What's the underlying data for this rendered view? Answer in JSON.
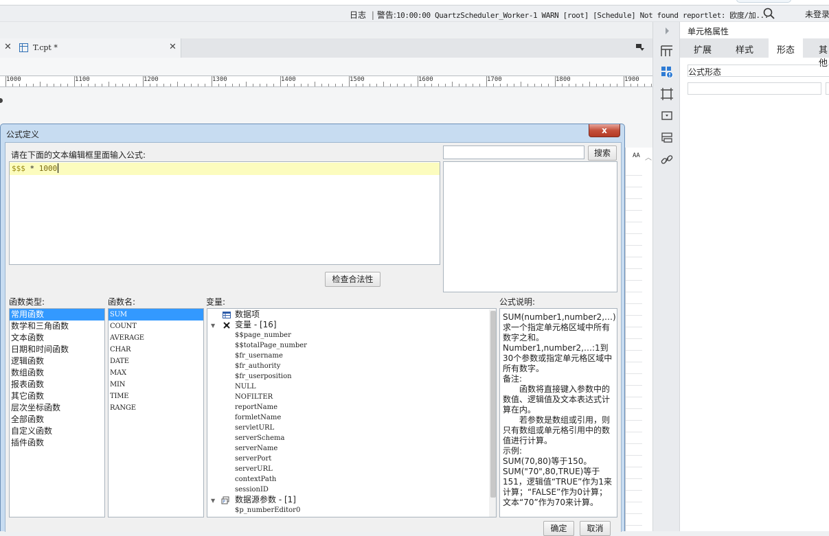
{
  "status_bar": {
    "log_label": "日志",
    "separator": "|",
    "warning_prefix": "警告:",
    "warning_message": "10:00:00 QuartzScheduler_Worker-1 WARN [root] [Schedule] Not found reportlet: 欧度/加...",
    "login_text": "未登录"
  },
  "tabs": [
    {
      "label": "T.cpt *",
      "modified": true
    }
  ],
  "ruler": {
    "labels": [
      "1000",
      "1100",
      "1200",
      "1300",
      "1400",
      "1500",
      "1600",
      "1700",
      "1800",
      "1900"
    ]
  },
  "sheet": {
    "header_label": "AA"
  },
  "icons": {
    "strip": [
      "expand-right-icon",
      "cell-element-icon",
      "cell-attribute-icon",
      "border-icon",
      "widget-icon",
      "condition-icon",
      "hyperlink-icon"
    ],
    "tab_file_icon": "grid-file-icon",
    "search_icon": "magnifier-icon"
  },
  "properties_panel": {
    "title": "单元格属性",
    "tabs": [
      "扩展",
      "样式",
      "形态",
      "其他"
    ],
    "active_tab": "形态",
    "format_label": "公式形态",
    "format_value": ""
  },
  "dialog": {
    "title": "公式定义",
    "close_label": "x",
    "prompt": "请在下面的文本编辑框里面输入公式:",
    "formula": {
      "var": "$$$",
      "op": " * ",
      "num": "1000"
    },
    "search_placeholder": "",
    "search_button": "搜索",
    "check_button": "检查合法性",
    "function_type_label": "函数类型:",
    "function_name_label": "函数名:",
    "variable_label": "变量:",
    "description_label": "公式说明:",
    "function_types": [
      "常用函数",
      "数学和三角函数",
      "文本函数",
      "日期和时间函数",
      "逻辑函数",
      "数组函数",
      "报表函数",
      "其它函数",
      "层次坐标函数",
      "全部函数",
      "自定义函数",
      "插件函数"
    ],
    "selected_function_type": "常用函数",
    "function_names": [
      "SUM",
      "COUNT",
      "AVERAGE",
      "CHAR",
      "DATE",
      "MAX",
      "MIN",
      "TIME",
      "RANGE"
    ],
    "selected_function_name": "SUM",
    "variables": {
      "data_items": "数据项",
      "variable_group": "变量 - [16]",
      "variable_items": [
        "$$page_number",
        "$$totalPage_number",
        "$fr_username",
        "$fr_authority",
        "$fr_userposition",
        "NULL",
        "NOFILTER",
        "reportName",
        "formletName",
        "servletURL",
        "serverSchema",
        "serverName",
        "serverPort",
        "serverURL",
        "contextPath",
        "sessionID"
      ],
      "datasource_group": "数据源参数 - [1]",
      "datasource_items": [
        "$p_numberEditor0"
      ]
    },
    "description": [
      {
        "text": "SUM(number1,number2,…): 求一个指定单元格区域中所有数字之和。",
        "indent": false
      },
      {
        "text": "Number1,number2,…:1到30个参数或指定单元格区域中所有数字。",
        "indent": false
      },
      {
        "text": "备注:",
        "indent": false
      },
      {
        "text": "函数将直接键入参数中的数值、逻辑值及文本表达式计算在内。",
        "indent": true
      },
      {
        "text": "若参数是数组或引用，则只有数组或单元格引用中的数值进行计算。",
        "indent": true
      },
      {
        "text": "示例:",
        "indent": false
      },
      {
        "text": "SUM(70,80)等于150。",
        "indent": false
      },
      {
        "text": "SUM(\"70\",80,TRUE)等于151，逻辑值“TRUE”作为1来计算；“FALSE”作为0计算；文本“70”作为70来计算。",
        "indent": false
      }
    ],
    "ok_button": "确定",
    "cancel_button": "取消"
  }
}
